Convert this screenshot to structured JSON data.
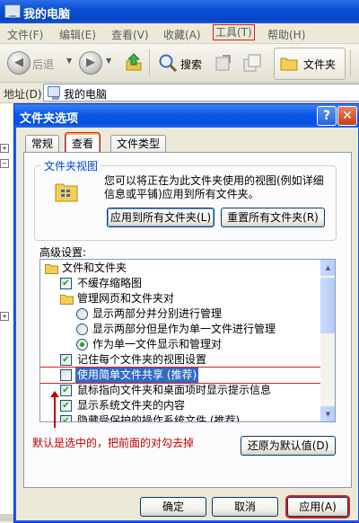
{
  "window": {
    "title": "我的电脑"
  },
  "menu": [
    {
      "label": "文件(F)",
      "name": "menu-file"
    },
    {
      "label": "编辑(E)",
      "name": "menu-edit"
    },
    {
      "label": "查看(V)",
      "name": "menu-view"
    },
    {
      "label": "收藏(A)",
      "name": "menu-favorites"
    },
    {
      "label": "工具(T)",
      "name": "menu-tools"
    },
    {
      "label": "帮助(H)",
      "name": "menu-help"
    }
  ],
  "toolbar": {
    "back_label": "后退",
    "search_label": "搜索",
    "folders_label": "文件夹"
  },
  "address": {
    "label": "地址(D)",
    "value": "我的电脑"
  },
  "dialog": {
    "title": "文件夹选项",
    "help": "?",
    "close": "✕",
    "tabs": [
      "常规",
      "查看",
      "文件类型"
    ],
    "active_tab": "查看",
    "folder_views": {
      "group_label": "文件夹视图",
      "description": "您可以将正在为此文件夹使用的视图(例如详细信息或平铺)应用到所有文件夹。",
      "apply_all_button": "应用到所有文件夹(L)",
      "reset_all_button": "重置所有文件夹(R)"
    },
    "advanced": {
      "label": "高级设置:",
      "items": [
        {
          "type": "folder",
          "text": "文件和文件夹",
          "level": 0
        },
        {
          "type": "checkbox",
          "text": "不缓存缩略图",
          "checked": true,
          "level": 1
        },
        {
          "type": "folder",
          "text": "管理网页和文件夹对",
          "level": 1
        },
        {
          "type": "radio",
          "text": "显示两部分并分别进行管理",
          "selected": false,
          "level": 2
        },
        {
          "type": "radio",
          "text": "显示两部分但是作为单一文件进行管理",
          "selected": false,
          "level": 2
        },
        {
          "type": "radio",
          "text": "作为单一文件显示和管理对",
          "selected": true,
          "level": 2
        },
        {
          "type": "checkbox",
          "text": "记住每个文件夹的视图设置",
          "checked": true,
          "level": 1
        },
        {
          "type": "checkbox",
          "text": "使用简单文件共享 (推荐)",
          "checked": false,
          "level": 1,
          "highlighted": true
        },
        {
          "type": "checkbox",
          "text": "鼠标指向文件夹和桌面项时显示提示信息",
          "checked": true,
          "level": 1
        },
        {
          "type": "checkbox",
          "text": "显示系统文件夹的内容",
          "checked": true,
          "level": 1
        },
        {
          "type": "checkbox",
          "text": "隐藏受保护的操作系统文件 (推荐)",
          "checked": true,
          "level": 1
        }
      ]
    },
    "annotation": "默认是选中的，把前面的对勾去掉",
    "restore_defaults_button": "还原为默认值(D)",
    "ok_button": "确定",
    "cancel_button": "取消",
    "apply_button": "应用(A)"
  },
  "colors": {
    "title_blue": "#0a58e8",
    "highlight_red": "#e21b1b",
    "selection": "#316ac5",
    "check_green": "#21a121"
  }
}
